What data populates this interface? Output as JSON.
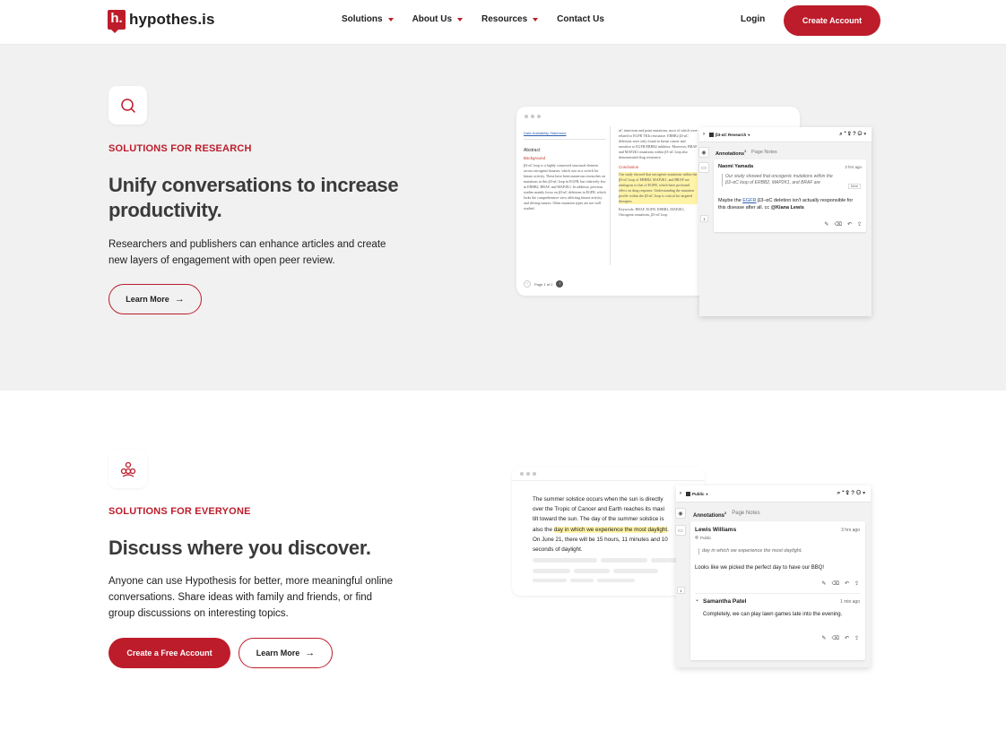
{
  "brand": {
    "logo_mark": "h.",
    "name": "hypothes.is",
    "accent": "#bd1c2b"
  },
  "nav": {
    "items": [
      {
        "label": "Solutions",
        "has_dropdown": true
      },
      {
        "label": "About Us",
        "has_dropdown": true
      },
      {
        "label": "Resources",
        "has_dropdown": true
      },
      {
        "label": "Contact Us",
        "has_dropdown": false
      }
    ],
    "login": "Login",
    "create_account": "Create Account"
  },
  "research": {
    "icon": "search-icon",
    "eyebrow": "SOLUTIONS FOR RESEARCH",
    "headline_line1": "Unify conversations to increase",
    "headline_line2": "productivity.",
    "body_line1": "Researchers and publishers can enhance articles and create",
    "body_line2": "new layers of engagement with open peer review.",
    "learn_more": "Learn More",
    "illustration": {
      "doc_link": "Data Availability Statement",
      "abstract_heading": "Abstract",
      "background_heading": "Background",
      "abstract_text": "β3-αC loop is a highly conserved structural element across oncogenic kinases, which acts as a switch for kinase activity. These have been numerous researches on mutations in this β3-αC loop in EGFR, but relatively few in ERBB2, BRAF, and MAP2K1. In addition, previous studies mainly focus on β3-αC deletions in EGFR, which lacks the comprehensive view affecting kinase activity and driving tumors. Other mutation types are not well studied.",
      "right_col_text": "αC insertions and point mutations, most of which were related to EGFR TKIs resistance. ERBB2 β3-αC deletions were only found in breast cancer and sensitive to EGFR/ERBB2 inhibitor. Moreover, BRAF and MAP2K1 mutations within β3-αC loop also demonstrated drug resistance.",
      "conclusion_heading": "Conclusion",
      "conclusion_text": "Our study showed that oncogenic mutations within the β3-αC loop of ERBB2, MAP2K1, and BRAF are analogous to that of EGFR, which have profound effect on drug response. Understanding the mutation profile within the β3-αC loop is critical for targeted therapies.",
      "keywords": "Keywords: BRAF, EGFR, ERBB2, MAP2K1, Oncogenic mutations, β3-αC loop",
      "page_indicator": "Page 1 of 2",
      "group": "β3-αC Research",
      "tab_annotations": "Annotations",
      "tab_annotations_count": "1",
      "tab_page_notes": "Page Notes",
      "side_count": "1",
      "annotation": {
        "user": "Naomi Yamada",
        "time": "3 hrs ago",
        "quote": "Our study showed that oncogenic mutations within the β3–αC loop of ERBB2, MAP2K1, and BRAF are",
        "quote_more": "More",
        "text_before": "Maybe the ",
        "link": "EGFR",
        "text_middle": " β3–αC deletion isn't actually responsible for this disease after all. cc ",
        "mention": "@Kiana Lewis"
      }
    }
  },
  "everyone": {
    "icon": "community-icon",
    "eyebrow": "SOLUTIONS FOR EVERYONE",
    "headline": "Discuss where you discover.",
    "body_line1": "Anyone can use Hypothesis for better, more meaningful online",
    "body_line2": "conversations. Share ideas with family and friends, or find",
    "body_line3": "group discussions on interesting topics.",
    "create_free": "Create a Free Account",
    "learn_more": "Learn More",
    "illustration": {
      "line1": "The summer solstice occurs when the sun is directly",
      "line2": "over the Tropic of Cancer and Earth reaches its maxi",
      "line3": "tilt toward the sun. The day of the summer solstice is",
      "line4_pre": "also the ",
      "line4_hl": "day in which we experience the most daylight",
      "line4_post": ".",
      "line5": "On June 21, there will be 15 hours, 11 minutes and 10",
      "line6": "seconds of daylight.",
      "group": "Public",
      "tab_annotations": "Annotations",
      "tab_annotations_count": "2",
      "tab_page_notes": "Page Notes",
      "side_count": "1",
      "annotations": [
        {
          "user": "Lewis Williams",
          "time": "3 hrs ago",
          "visibility": "Public",
          "quote": "day in which we experience the most daylight.",
          "text": "Looks like we picked the perfect day to have our BBQ!"
        },
        {
          "user": "Samantha Patel",
          "time": "1 min ago",
          "text": "Completely, we can play lawn games late into the evening."
        }
      ]
    }
  }
}
